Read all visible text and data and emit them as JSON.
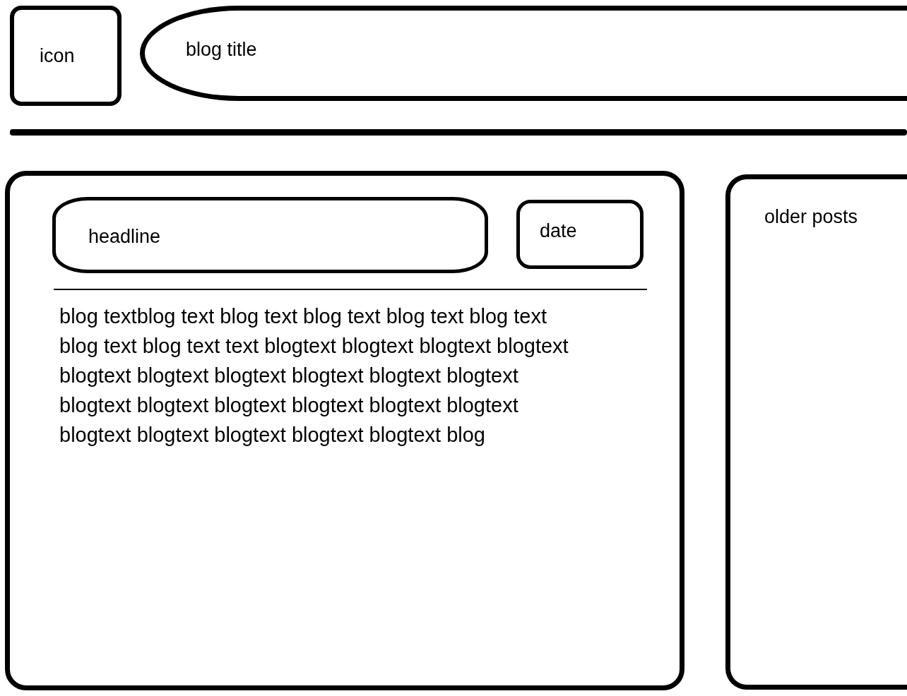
{
  "header": {
    "icon_label": "icon",
    "title": "blog title"
  },
  "post": {
    "headline": "headline",
    "date": "date",
    "body": "blog textblog text blog text blog text blog text blog text blog text blog text text blogtext blogtext blogtext blogtext blogtext blogtext blogtext blogtext blogtext blogtext blogtext blogtext blogtext blogtext blogtext blogtext blogtext blogtext blogtext blogtext blogtext blog"
  },
  "sidebar": {
    "title": "older posts"
  }
}
